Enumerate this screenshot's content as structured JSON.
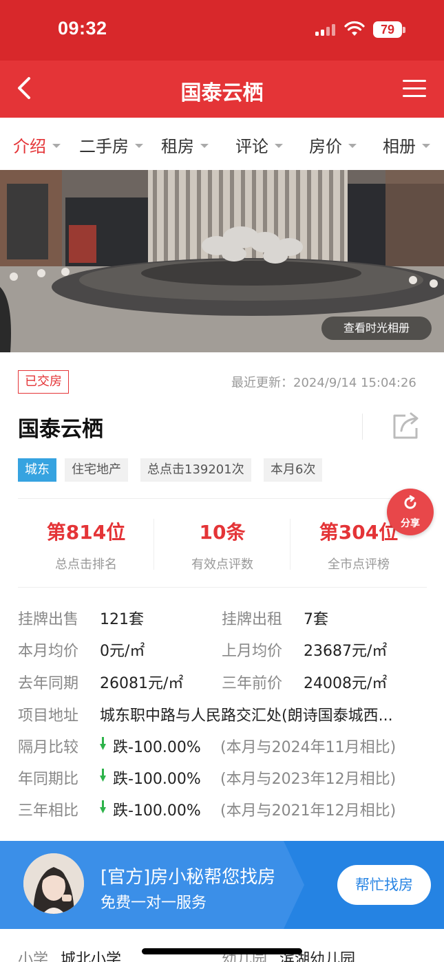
{
  "status_bar": {
    "time": "09:32",
    "battery": "79"
  },
  "header": {
    "title": "国泰云栖",
    "back_icon": "chevron-left-icon",
    "menu_icon": "hamburger-menu-icon"
  },
  "tabs": [
    {
      "label": "介绍",
      "active": true
    },
    {
      "label": "二手房",
      "active": false
    },
    {
      "label": "租房",
      "active": false
    },
    {
      "label": "评论",
      "active": false
    },
    {
      "label": "房价",
      "active": false
    },
    {
      "label": "相册",
      "active": false
    }
  ],
  "hero": {
    "album_button": "查看时光相册"
  },
  "project": {
    "status_badge": "已交房",
    "update_time": "最近更新：2024/9/14 15:04:26",
    "name": "国泰云栖",
    "tags": [
      "城东",
      "住宅地产",
      "总点击139201次",
      "本月6次"
    ]
  },
  "stats": [
    {
      "value": "第814位",
      "label": "总点击排名"
    },
    {
      "value": "10条",
      "label": "有效点评数"
    },
    {
      "value": "第304位",
      "label": "全市点评榜"
    }
  ],
  "share_button": "分享",
  "details": {
    "rows": [
      {
        "label": "挂牌出售",
        "value": "121套",
        "label2": "挂牌出租",
        "value2": "7套"
      },
      {
        "label": "本月均价",
        "value": "0元/㎡",
        "label2": "上月均价",
        "value2": "23687元/㎡"
      },
      {
        "label": "去年同期",
        "value": "26081元/㎡",
        "label2": "三年前价",
        "value2": "24008元/㎡"
      }
    ],
    "address_label": "项目地址",
    "address_value": "城东职中路与人民路交汇处(朗诗国泰城西...",
    "trends": [
      {
        "label": "隔月比较",
        "value": "跌-100.00%",
        "note": "(本月与2024年11月相比)"
      },
      {
        "label": "年同期比",
        "value": "跌-100.00%",
        "note": "(本月与2023年12月相比)"
      },
      {
        "label": "三年相比",
        "value": "跌-100.00%",
        "note": "(本月与2021年12月相比)"
      }
    ]
  },
  "banner": {
    "title": "[官方]房小秘帮您找房",
    "subtitle": "免费一对一服务",
    "button": "帮忙找房"
  },
  "schools": {
    "primary_label": "小学",
    "primary_value": "城北小学",
    "kindergarten_label": "幼儿园",
    "kindergarten_value": "滨湖幼儿园"
  },
  "colors": {
    "brand_red": "#e43437",
    "status_red": "#d8282b",
    "district_blue": "#36a3e0",
    "banner_blue": "#2583e3",
    "trend_green": "#2db34a"
  }
}
